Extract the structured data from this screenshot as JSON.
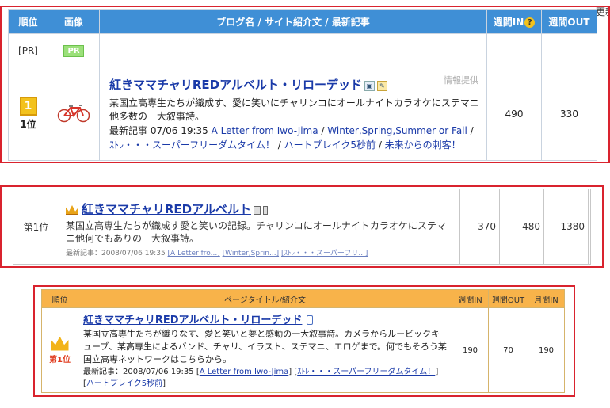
{
  "stray_text": "更新",
  "panel1": {
    "headers": {
      "rank": "順位",
      "image": "画像",
      "blog": "ブログ名 / サイト紹介文 / 最新記事",
      "weekly_in": "週間IN",
      "weekly_out": "週間OUT"
    },
    "help_icon": "?",
    "pr_row": {
      "rank": "[PR]",
      "badge": "PR",
      "in": "–",
      "out": "–"
    },
    "entry": {
      "rank_badge": "1",
      "rank": "1位",
      "title": "紅きママチャリREDアルベルト・リローデッド",
      "info_provider": "情報提供",
      "desc_line1": "某国立高専生たちが織成す、愛に笑いにチャリンコにオールナイトカラオケにステマニ",
      "desc_line2": "他多数の一大叙事詩。",
      "latest_prefix": "最新記事 07/06 19:35 ",
      "latest_link1": "A Letter from Iwo-Jima",
      "sep": " / ",
      "latest_link2": "Winter,Spring,Summer or Fall",
      "latest_link3": "ｽﾄﾚ・・・スーパーフリーダムタイム！",
      "latest_link4": "ハートブレイク5秒前",
      "latest_link5": "未来からの刺客！",
      "in": "490",
      "out": "330"
    }
  },
  "panel2": {
    "rank": "第1位",
    "title": "紅きママチャリREDアルベルト",
    "desc": "某国立高専生たちが織成す愛と笑いの記録。チャリンコにオールナイトカラオケにステマニ他何でもありの一大叙事詩。",
    "latest_prefix": "最新記事：2008/07/06 19:35 ",
    "link1": "[A Letter fro...]",
    "link2": "[Winter,Sprin...]",
    "link3": "[ｽﾄﾚ・・・スーパーフリ...]",
    "n1": "370",
    "n2": "480",
    "n3": "1380"
  },
  "panel3": {
    "headers": {
      "rank": "順位",
      "title": "ページタイトル/紹介文",
      "weekly_in": "週間IN",
      "weekly_out": "週間OUT",
      "monthly_in": "月間IN"
    },
    "rank_label": "第1位",
    "title": "紅きママチャリREDアルベルト・リローデッド",
    "desc": "某国立高専生たちが織りなす、愛と笑いと夢と感動の一大叙事詩。カメラからルービックキューブ、某高専生によるバンド、チャリ、イラスト、ステマニ、エロゲまで。何でもそろう某国立高専ネットワークはこちらから。",
    "latest_prefix": "最新記事：2008/07/06 19:35 ",
    "link1": "A Letter from Iwo-Jima",
    "link2": "ｽﾄﾚ・・・スーパーフリーダムタイム！",
    "link3": "ハートブレイク5秒前",
    "in": "190",
    "out": "70",
    "month": "190"
  }
}
